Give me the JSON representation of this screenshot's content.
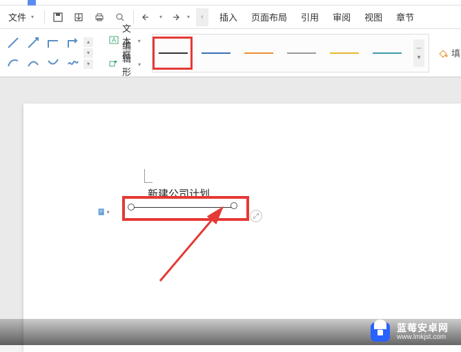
{
  "menu": {
    "file_label": "文件",
    "tabs": {
      "insert": "插入",
      "page_layout": "页面布局",
      "references": "引用",
      "review": "审阅",
      "view": "视图",
      "chapter": "章节"
    }
  },
  "ribbon": {
    "text_box_label": "文本框",
    "edit_shape_label": "编辑形状",
    "fill_control_partial": "填",
    "line_styles": [
      {
        "name": "black",
        "color": "#333333",
        "selected": true
      },
      {
        "name": "blue",
        "color": "#3b6fb5",
        "selected": false
      },
      {
        "name": "orange",
        "color": "#e8902e",
        "selected": false
      },
      {
        "name": "gray",
        "color": "#9a9a9a",
        "selected": false
      },
      {
        "name": "yellow",
        "color": "#e6b82c",
        "selected": false
      },
      {
        "name": "teal",
        "color": "#3d9aa8",
        "selected": false
      }
    ]
  },
  "document": {
    "title_text": "新建公司计划"
  },
  "annotation": {
    "highlight_color": "#e53935"
  },
  "watermark": {
    "brand": "蓝莓安卓网",
    "url": "www.lmkjst.com"
  }
}
